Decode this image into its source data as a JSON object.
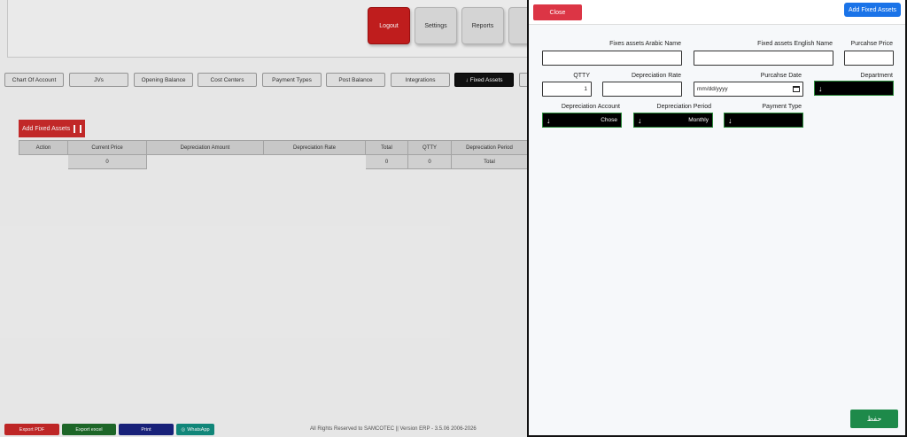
{
  "top_buttons": [
    "Logout",
    "Settings",
    "Reports"
  ],
  "nav_tabs": [
    "Chart Of Account",
    "JVs",
    "Opening Balance",
    "Cost Centers",
    "Payment Types",
    "Post Balance",
    "Integrations",
    "Fixed Assets"
  ],
  "add_fixed_assets_label": "Add Fixed Assets",
  "table": {
    "headers": [
      "Action",
      "Current Price",
      "Depreciation Amount",
      "Depreciation Rate",
      "Total",
      "QTTY",
      "Depreciation Period"
    ],
    "row": [
      "",
      "0",
      "",
      "",
      "0",
      "0",
      "Total"
    ]
  },
  "footer": {
    "export_pdf": "Export PDF",
    "export_excel": "Export excel",
    "print": "Print",
    "whatsapp": "WhatsApp",
    "copyright": "All Rights Reserved to SAMCOTEC || Version ERP - 3.5.06 2006-2026"
  },
  "modal": {
    "close_label": "Close",
    "add_label": "Add Fixed Assets",
    "fields": {
      "arabic_name_label": "Fixes assets Arabic Name",
      "english_name_label": "Fixed assets English Name",
      "purchase_price_label": "Purcahse Price",
      "qtty_label": "QTTY",
      "qtty_value": "1",
      "depreciation_rate_label": "Depreciation Rate",
      "purchase_date_label": "Purcahse Date",
      "purchase_date_placeholder": "mm/dd/yyyy",
      "department_label": "Department",
      "depreciation_account_label": "Depreciation Account",
      "depreciation_account_value": "Chose",
      "depreciation_period_label": "Depreciation Period",
      "depreciation_period_value": "Monthly",
      "payment_type_label": "Payment Type"
    },
    "save_label": "حفظ"
  },
  "colors": {
    "danger": "#dc3545",
    "primary": "#1a73e8",
    "success": "#1e8a4a",
    "logout": "#c71f1f"
  }
}
